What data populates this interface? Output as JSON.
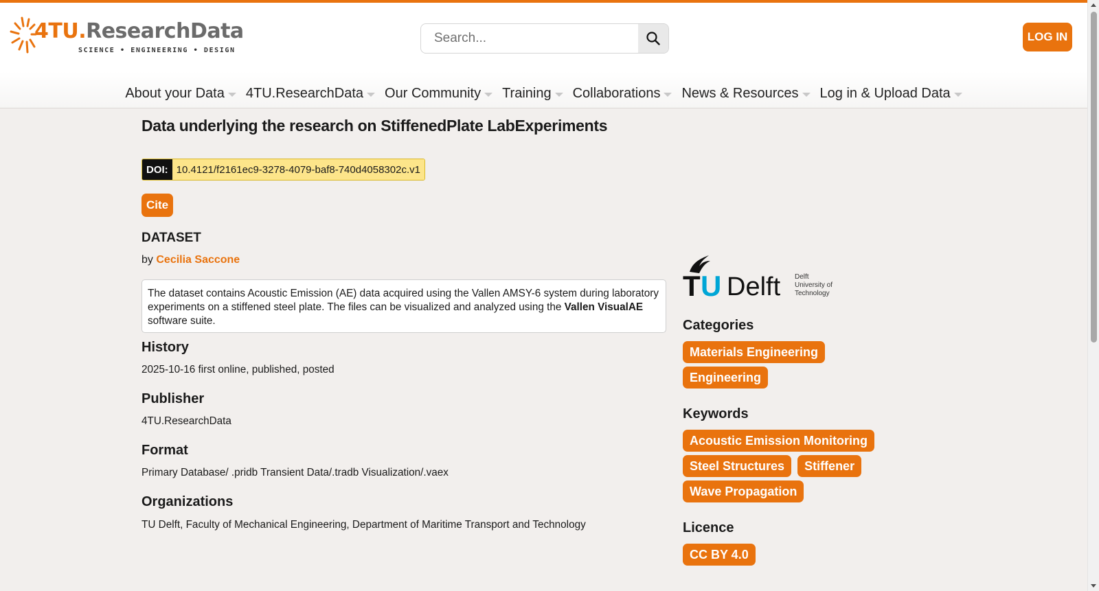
{
  "header": {
    "logo_main": "4TU.",
    "logo_rest": "ResearchData",
    "logo_tagline": "SCIENCE • ENGINEERING • DESIGN",
    "search_placeholder": "Search...",
    "login_label": "LOG IN"
  },
  "nav": {
    "items": [
      {
        "label": "About your Data"
      },
      {
        "label": "4TU.ResearchData"
      },
      {
        "label": "Our Community"
      },
      {
        "label": "Training"
      },
      {
        "label": "Collaborations"
      },
      {
        "label": "News & Resources"
      },
      {
        "label": "Log in & Upload Data"
      }
    ]
  },
  "dataset": {
    "title": "Data underlying the research on StiffenedPlate LabExperiments",
    "doi_label": "DOI:",
    "doi_value": "10.4121/f2161ec9-3278-4079-baf8-740d4058302c.v1",
    "cite_label": "Cite",
    "type": "DATASET",
    "by_prefix": "by",
    "author": "Cecilia Saccone",
    "description_part1": "The dataset contains Acoustic Emission (AE) data acquired using the Vallen AMSY-6 system during laboratory experiments on a stiffened steel plate. The files can be visualized and analyzed using the",
    "description_bold": "Vallen VisualAE",
    "description_part2": "software suite."
  },
  "sections": {
    "history_title": "History",
    "history_value": "2025-10-16 first online, published, posted",
    "publisher_title": "Publisher",
    "publisher_value": "4TU.ResearchData",
    "format_title": "Format",
    "format_value": "Primary Database/ .pridb Transient Data/.tradb Visualization/.vaex",
    "organizations_title": "Organizations",
    "organizations_value": "TU Delft, Faculty of Mechanical Engineering, Department of Maritime Transport and Technology"
  },
  "sidebar": {
    "institution_logo_text": "TUDelft",
    "institution_logo_sub1": "Delft",
    "institution_logo_sub2": "University of",
    "institution_logo_sub3": "Technology",
    "categories_title": "Categories",
    "categories": [
      "Materials Engineering",
      "Engineering"
    ],
    "keywords_title": "Keywords",
    "keywords": [
      "Acoustic Emission Monitoring",
      "Steel Structures",
      "Stiffener",
      "Wave Propagation"
    ],
    "licence_title": "Licence",
    "licence": "CC BY 4.0"
  },
  "colors": {
    "accent": "#e9730e",
    "tudelft_blue": "#00a6d6",
    "doi_highlight": "#fde58a"
  },
  "icons": {
    "search": "search-icon",
    "caret": "caret-down-icon",
    "logo_mark": "sunburst-logo-icon",
    "tud_flame": "tudelft-flame-icon"
  }
}
